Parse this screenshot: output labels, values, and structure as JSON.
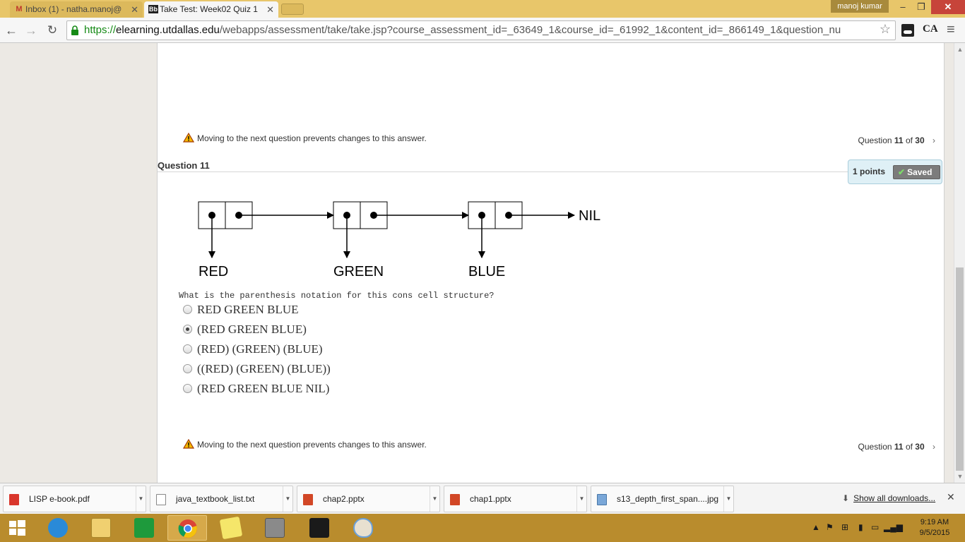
{
  "browser": {
    "tabs": [
      {
        "label": "Inbox (1) - natha.manoj@",
        "icon": "gmail-icon"
      },
      {
        "label": "Take Test: Week02 Quiz 1",
        "icon": "blackboard-icon"
      }
    ],
    "user_name": "manoj kumar",
    "url_scheme": "https://",
    "url_host": "elearning.utdallas.edu",
    "url_rest": "/webapps/assessment/take/take.jsp?course_assessment_id=_63649_1&course_id=_61992_1&content_id=_866149_1&question_nu",
    "ext_label": "CA"
  },
  "page": {
    "warning_text": "Moving to the next question prevents changes to this answer.",
    "qnav": {
      "prefix": "Question",
      "current": "11",
      "of_label": "of",
      "total": "30"
    },
    "question_heading": "Question 11",
    "points_label": "1 points",
    "saved_label": "Saved",
    "diagram": {
      "labels": [
        "RED",
        "GREEN",
        "BLUE"
      ],
      "terminator": "NIL"
    },
    "question_text": "What is the parenthesis notation for this cons cell structure?",
    "options": [
      {
        "text": "RED GREEN BLUE",
        "selected": false
      },
      {
        "text": "(RED GREEN BLUE)",
        "selected": true
      },
      {
        "text": "(RED) (GREEN) (BLUE)",
        "selected": false
      },
      {
        "text": "((RED) (GREEN) (BLUE))",
        "selected": false
      },
      {
        "text": "(RED GREEN BLUE NIL)",
        "selected": false
      }
    ]
  },
  "downloads": {
    "items": [
      {
        "name": "LISP e-book.pdf",
        "icon": "pdf-icon"
      },
      {
        "name": "java_textbook_list.txt",
        "icon": "text-file-icon"
      },
      {
        "name": "chap2.pptx",
        "icon": "powerpoint-icon"
      },
      {
        "name": "chap1.pptx",
        "icon": "powerpoint-icon"
      },
      {
        "name": "s13_depth_first_span....jpg",
        "icon": "image-file-icon"
      }
    ],
    "show_all_label": "Show all downloads..."
  },
  "taskbar": {
    "apps": [
      "start-icon",
      "internet-explorer-icon",
      "file-explorer-icon",
      "store-icon",
      "chrome-icon",
      "sticky-notes-icon",
      "app-icon",
      "menorah-app-icon",
      "paint-icon"
    ],
    "time": "9:19 AM",
    "date": "9/5/2015"
  },
  "colors": {
    "titlebar": "#e8c66a",
    "taskbar": "#b98c2d",
    "saved_badge": "#7c7c7c",
    "points_box": "#dff0f6"
  }
}
